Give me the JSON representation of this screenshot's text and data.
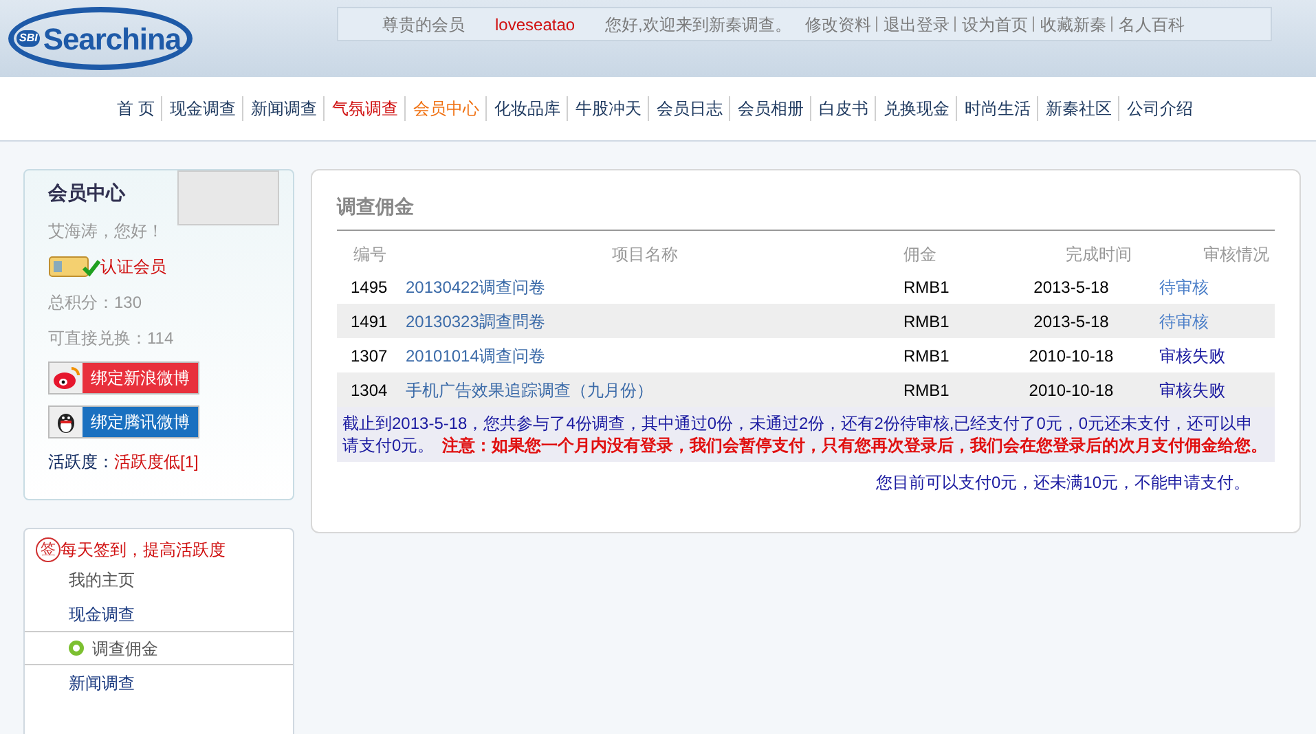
{
  "header": {
    "logo": "Searchina",
    "logo_badge": "SBI",
    "greeting_prefix": "尊贵的会员",
    "username": "loveseatao",
    "greeting_suffix": "您好,欢迎来到新秦调查。",
    "links": [
      "修改资料",
      "退出登录",
      "设为首页",
      "收藏新秦",
      "名人百科"
    ]
  },
  "nav": [
    {
      "label": "首 页",
      "kind": "normal",
      "selected": false
    },
    {
      "label": "现金调查",
      "kind": "normal",
      "selected": false
    },
    {
      "label": "新闻调查",
      "kind": "normal",
      "selected": false
    },
    {
      "label": "气氛调查",
      "kind": "hot",
      "selected": false
    },
    {
      "label": "会员中心",
      "kind": "normal",
      "selected": true
    },
    {
      "label": "化妆品库",
      "kind": "normal",
      "selected": false
    },
    {
      "label": "牛股冲天",
      "kind": "normal",
      "selected": false
    },
    {
      "label": "会员日志",
      "kind": "normal",
      "selected": false
    },
    {
      "label": "会员相册",
      "kind": "normal",
      "selected": false
    },
    {
      "label": "白皮书",
      "kind": "normal",
      "selected": false
    },
    {
      "label": "兑换现金",
      "kind": "normal",
      "selected": false
    },
    {
      "label": "时尚生活",
      "kind": "normal",
      "selected": false
    },
    {
      "label": "新秦社区",
      "kind": "normal",
      "selected": false
    },
    {
      "label": "公司介绍",
      "kind": "normal",
      "selected": false
    }
  ],
  "member": {
    "title": "会员中心",
    "hello": "艾海涛，您好！",
    "verified": "认证会员",
    "points": "总积分：130",
    "exchangeable": "可直接兑换：114",
    "buttons": [
      {
        "label": "绑定新浪微博",
        "kind": "weibo"
      },
      {
        "label": "绑定腾讯微博",
        "kind": "tencent"
      }
    ],
    "activity_label": "活跃度：",
    "activity_value": "活跃度低[1]"
  },
  "menu": {
    "signin_icon": "签",
    "signin": "每天签到，提高活跃度",
    "items": [
      {
        "label": "我的主页",
        "selected": false
      },
      {
        "label": "现金调查",
        "selected": false
      },
      {
        "label": "调查佣金",
        "selected": true
      },
      {
        "label": "新闻调查",
        "selected": false
      }
    ]
  },
  "panel": {
    "title": "调查佣金",
    "columns": [
      "编号",
      "项目名称",
      "佣金",
      "完成时间",
      "审核情况"
    ],
    "rows": [
      {
        "id": "1495",
        "name": "20130422调查问卷",
        "commission": "RMB1",
        "date": "2013-5-18",
        "status": "待审核",
        "kind": "pending"
      },
      {
        "id": "1491",
        "name": "20130323調查問卷",
        "commission": "RMB1",
        "date": "2013-5-18",
        "status": "待审核",
        "kind": "pending"
      },
      {
        "id": "1307",
        "name": "20101014调查问卷",
        "commission": "RMB1",
        "date": "2010-10-18",
        "status": "审核失败",
        "kind": "failed"
      },
      {
        "id": "1304",
        "name": "手机广告效果追踪调查（九月份）",
        "commission": "RMB1",
        "date": "2010-10-18",
        "status": "审核失败",
        "kind": "failed"
      }
    ],
    "notice": "截止到2013-5-18，您共参与了4份调查，其中通过0份，未通过2份，还有2份待审核,已经支付了0元，0元还未支付，还可以申请支付0元。",
    "warning": "注意：如果您一个月内没有登录，我们会暂停支付，只有您再次登录后，我们会在您登录后的次月支付佣金给您。",
    "footer": "您目前可以支付0元，还未满10元，不能申请支付。"
  }
}
